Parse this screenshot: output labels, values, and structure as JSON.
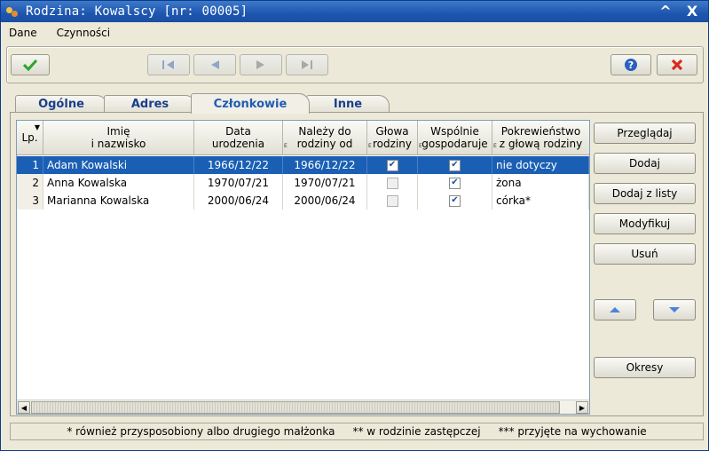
{
  "window": {
    "title": "Rodzina: Kowalscy [nr: 00005]",
    "minimize": "^",
    "close": "X"
  },
  "menu": [
    {
      "label": "Dane"
    },
    {
      "label": "Czynności"
    }
  ],
  "toolbar": {
    "accept_icon": "check-icon",
    "nav_icons": [
      "first-record-icon",
      "previous-record-icon",
      "next-record-icon",
      "last-record-icon"
    ],
    "help_icon": "question-icon",
    "cancel_icon": "red-x-icon",
    "colors": {
      "accept": "#2aa52a",
      "cancel": "#d82a1a",
      "help": "#2b5fc0"
    }
  },
  "tabs": [
    {
      "label": "Ogólne"
    },
    {
      "label": "Adres"
    },
    {
      "label": "Członkowie",
      "active": true
    },
    {
      "label": "Inne"
    }
  ],
  "table": {
    "columns": [
      {
        "label": "Lp."
      },
      {
        "label": "Imię\ni nazwisko"
      },
      {
        "label": "Data\nurodzenia"
      },
      {
        "label": "Należy do\nrodziny od"
      },
      {
        "label": "Głowa\nrodziny"
      },
      {
        "label": "Wspólnie\ngospodaruje"
      },
      {
        "label": "Pokrewieństwo\nz głową rodziny"
      }
    ],
    "rows": [
      {
        "lp": "1",
        "name": "Adam Kowalski",
        "birth": "1966/12/22",
        "since": "1966/12/22",
        "head": true,
        "shared": true,
        "relation": "nie dotyczy",
        "selected": true
      },
      {
        "lp": "2",
        "name": "Anna Kowalska",
        "birth": "1970/07/21",
        "since": "1970/07/21",
        "head": false,
        "shared": true,
        "relation": "żona",
        "selected": false
      },
      {
        "lp": "3",
        "name": "Marianna Kowalska",
        "birth": "2000/06/24",
        "since": "2000/06/24",
        "head": false,
        "shared": true,
        "relation": "córka*",
        "selected": false
      }
    ]
  },
  "side_buttons": {
    "browse": "Przeglądaj",
    "add": "Dodaj",
    "add_from_list": "Dodaj z listy",
    "modify": "Modyfikuj",
    "delete": "Usuń",
    "periods": "Okresy"
  },
  "footer": {
    "note1": "* również przysposobiony albo drugiego małżonka",
    "note2": "** w rodzinie zastępczej",
    "note3": "*** przyjęte na wychowanie"
  }
}
